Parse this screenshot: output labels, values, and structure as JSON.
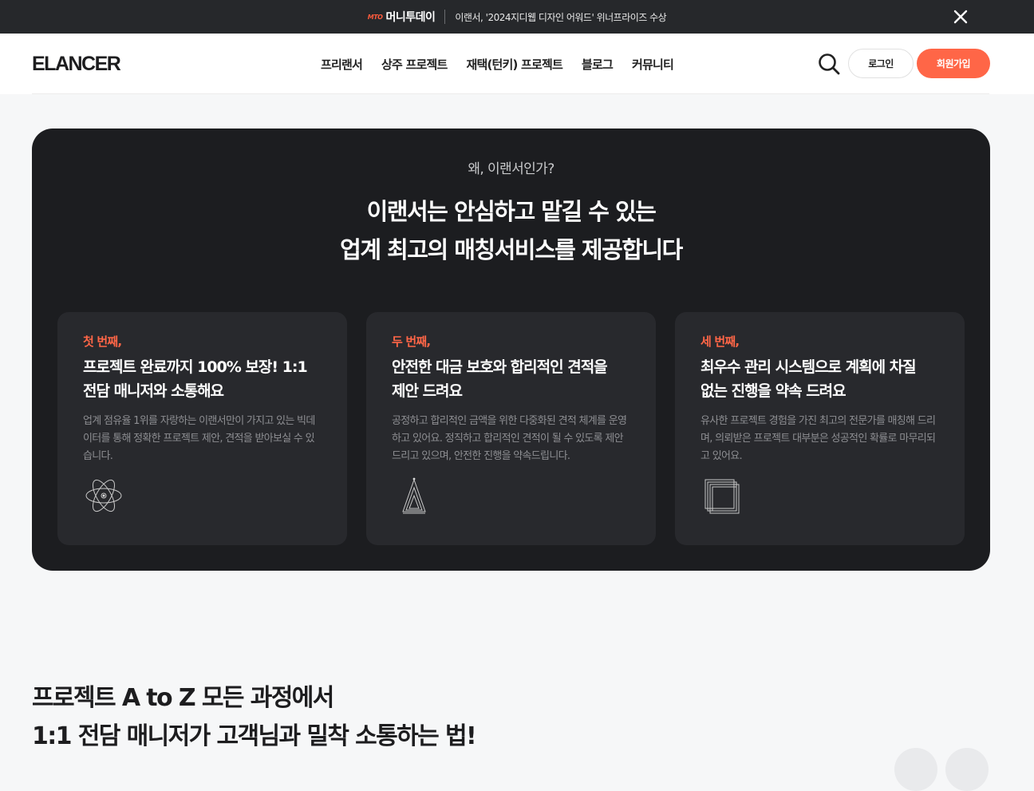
{
  "banner": {
    "mark": "MTO",
    "brand": "머니투데이",
    "text": "이랜서, '2024지디웹 디자인 어워드' 위너프라이즈 수상",
    "close_icon": "close-icon"
  },
  "header": {
    "logo_text": "ELANCER",
    "nav": [
      "프리랜서",
      "상주 프로젝트",
      "재택(턴키) 프로젝트",
      "블로그",
      "커뮤니티"
    ],
    "search_icon": "search-icon",
    "login_label": "로그인",
    "signup_label": "회원가입"
  },
  "why": {
    "eyebrow": "왜, 이랜서인가?",
    "title_line1": "이랜서는 안심하고 맡길 수 있는",
    "title_line2": "업계 최고의 매칭서비스를 제공합니다",
    "cards": [
      {
        "label": "첫 번째,",
        "title": "프로젝트 완료까지 100% 보장! 1:1 전담 매니저와 소통해요",
        "desc": "업계 점유율 1위를 자랑하는 이랜서만이 가지고 있는 빅데이터를 통해 정확한 프로젝트 제안, 견적을 받아보실 수 있습니다.",
        "icon": "atom-icon"
      },
      {
        "label": "두 번째,",
        "title": "안전한 대금 보호와 합리적인 견적을 제안 드려요",
        "desc": "공정하고 합리적인 금액을 위한 다중화된 견적 체계를 운영하고 있어요. 정직하고 합리적인 견적이 될 수 있도록 제안 드리고 있으며, 안전한 진행을 약속드립니다.",
        "icon": "triangle-icon"
      },
      {
        "label": "세 번째,",
        "title": "최우수 관리 시스템으로 계획에 차질 없는 진행을 약속 드려요",
        "desc": "유사한 프로젝트 경험을 가진 최고의 전문가를 매칭해 드리며, 의뢰받은 프로젝트 대부분은 성공적인 확률로 마무리되고 있어요.",
        "icon": "stacked-squares-icon"
      }
    ]
  },
  "process": {
    "title_line1": "프로젝트 A to Z 모든 과정에서",
    "title_line2": "1:1 전담 매니저가 고객님과 밀착 소통하는 법!"
  },
  "colors": {
    "accent": "#ff6647",
    "dark_panel": "#1c1d20",
    "card": "#28292d",
    "banner": "#26282b"
  }
}
